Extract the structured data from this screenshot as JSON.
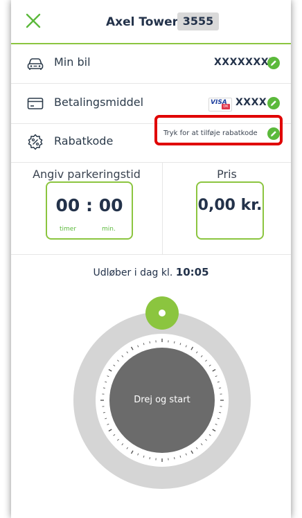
{
  "header": {
    "title": "Axel Towers",
    "badge": "3555"
  },
  "rows": {
    "car": {
      "label": "Min bil",
      "value": "XXXXXXXX"
    },
    "payment": {
      "label": "Betalingsmiddel",
      "card_brand": "VISA",
      "card_sub": "DK",
      "value": "XXXX"
    },
    "discount": {
      "label": "Rabatkode",
      "action": "Tryk for at tilføje rabatkode"
    }
  },
  "duration": {
    "label": "Angiv parkeringstid",
    "value": "00 : 00",
    "unit_hours": "timer",
    "unit_minutes": "min."
  },
  "price": {
    "label": "Pris",
    "value": "0,00 kr."
  },
  "expiry": {
    "prefix": "Udløber i dag kl.",
    "time": "10:05"
  },
  "dial": {
    "label": "Drej og start"
  },
  "colors": {
    "accent": "#8bc53f",
    "edit": "#5bb93b",
    "highlight": "#e00000",
    "dial_center": "#6b6b6b",
    "dial_ring": "#d5d5d5"
  }
}
